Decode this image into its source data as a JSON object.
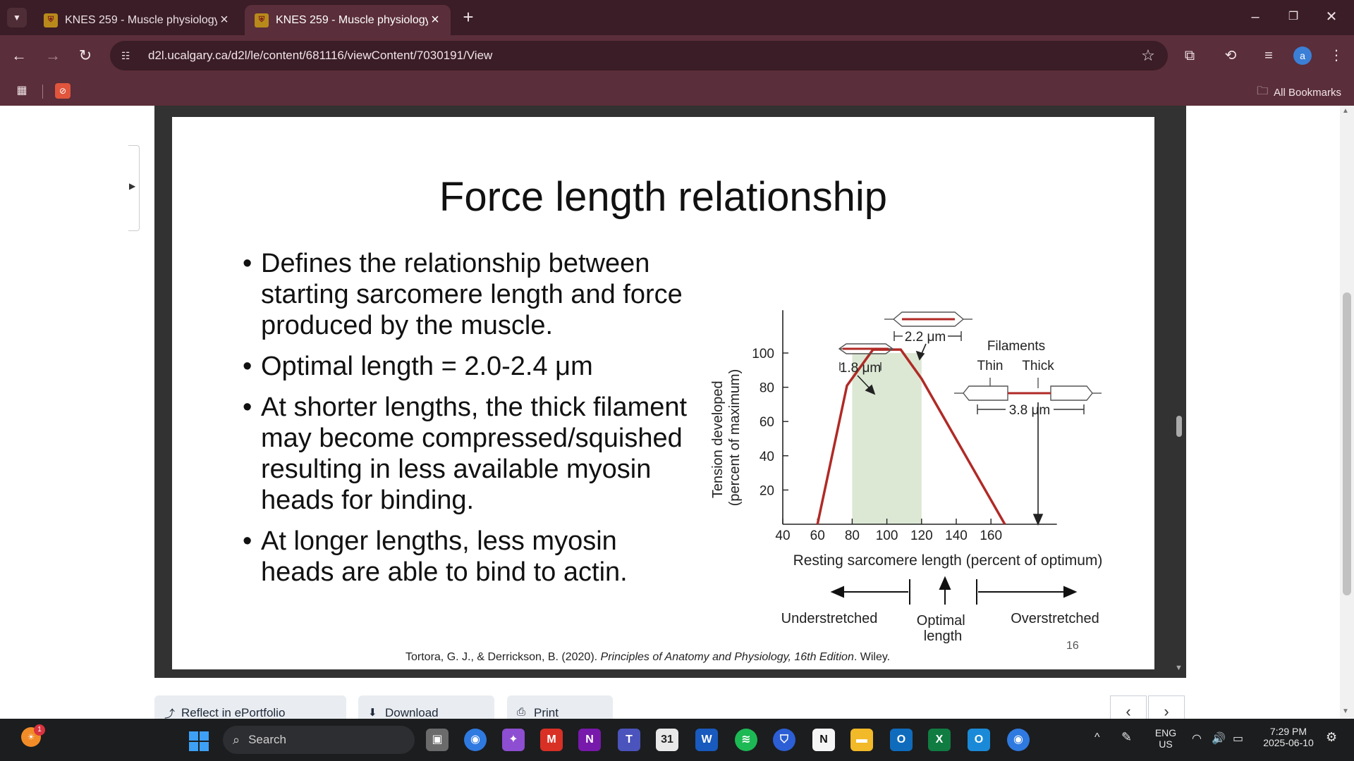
{
  "browser": {
    "tabs": [
      {
        "title": "KNES 259 - Muscle physiology",
        "active": false
      },
      {
        "title": "KNES 259 - Muscle physiology",
        "active": true
      }
    ],
    "url": "d2l.ucalgary.ca/d2l/le/content/681116/viewContent/7030191/View",
    "all_bookmarks": "All Bookmarks",
    "profile_initial": "a"
  },
  "slide": {
    "title": "Force length relationship",
    "bullets": [
      "Defines the relationship between starting sarcomere length and force produced by the muscle.",
      "Optimal length = 2.0-2.4 μm",
      "At shorter lengths, the thick filament may become compressed/squished resulting in less available myosin heads for binding.",
      "At longer lengths, less myosin heads are able to bind to actin."
    ],
    "citation_authors": "Tortora, G. J., & Derrickson, B. (2020). ",
    "citation_book": "Principles of Anatomy and Physiology, 16th Edition",
    "citation_publisher": ". Wiley.",
    "slide_number": "16"
  },
  "chart_data": {
    "type": "line",
    "xlabel": "Resting sarcomere length (percent of optimum)",
    "ylabel_line1": "Tension developed",
    "ylabel_line2": "(percent of maximum)",
    "x_ticks": [
      40,
      60,
      80,
      100,
      120,
      140,
      160
    ],
    "y_ticks": [
      20,
      40,
      60,
      80,
      100
    ],
    "xlim": [
      40,
      200
    ],
    "ylim": [
      0,
      125
    ],
    "series": [
      {
        "x": [
          60,
          77,
          92,
          108,
          120,
          168
        ],
        "y": [
          0,
          81,
          102,
          102,
          85,
          0
        ]
      }
    ],
    "optimal_band": [
      80,
      120
    ],
    "colors": {
      "curve": "#b02a26",
      "band": "#dce8d4"
    },
    "annotations": {
      "short_length": "1.8 μm",
      "optimal_length": "2.2 μm",
      "long_length": "3.8 μm",
      "filaments": "Filaments",
      "thin": "Thin",
      "thick": "Thick",
      "understretched": "Understretched",
      "optimal_line1": "Optimal",
      "optimal_line2": "length",
      "overstretched": "Overstretched"
    }
  },
  "page_actions": {
    "reflect": "Reflect in ePortfolio",
    "download": "Download",
    "print": "Print"
  },
  "taskbar": {
    "search": "Search",
    "notification_count": "1",
    "lang_line1": "ENG",
    "lang_line2": "US",
    "time": "7:29 PM",
    "date": "2025-06-10"
  }
}
